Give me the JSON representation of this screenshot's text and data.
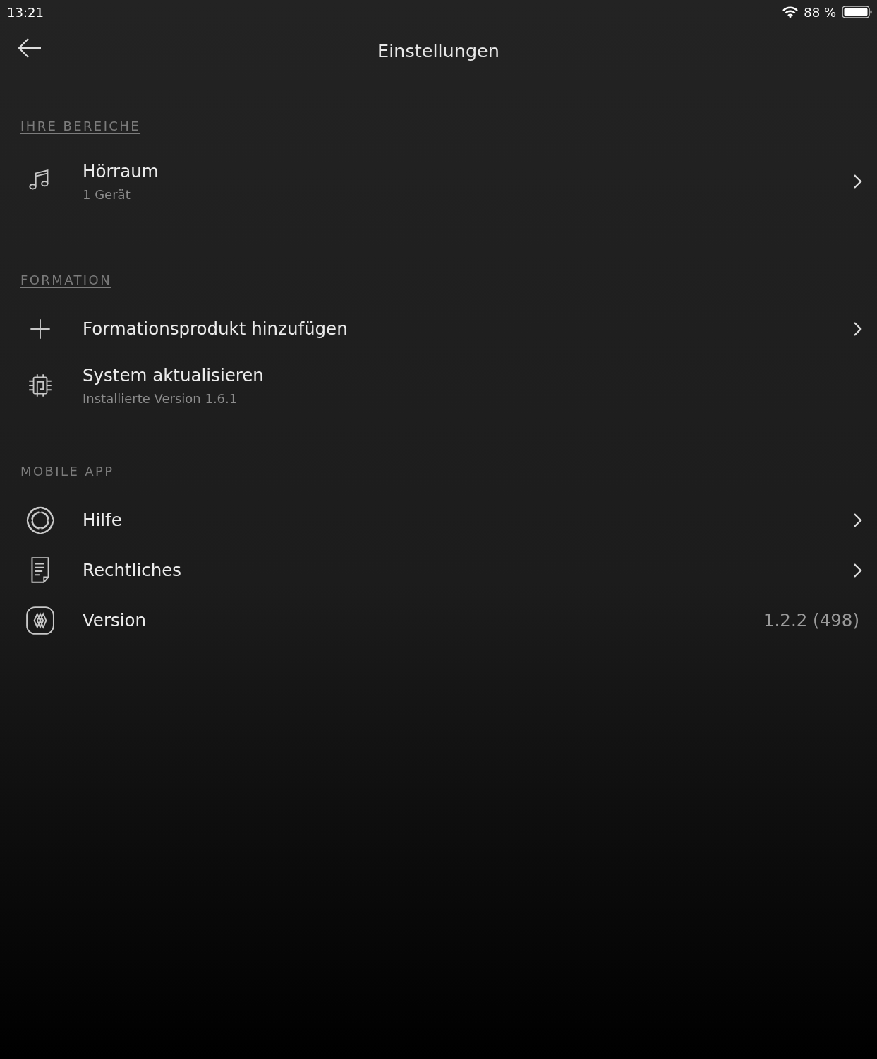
{
  "status_bar": {
    "time": "13:21",
    "battery_text": "88 %"
  },
  "header": {
    "title": "Einstellungen"
  },
  "sections": [
    {
      "label": "IHRE BEREICHE",
      "rows": [
        {
          "title": "Hörraum",
          "subtitle": "1 Gerät",
          "chevron": true
        }
      ]
    },
    {
      "label": "FORMATION",
      "rows": [
        {
          "title": "Formationsprodukt hinzufügen",
          "chevron": true
        },
        {
          "title": "System aktualisieren",
          "subtitle": "Installierte Version 1.6.1",
          "chevron": false
        }
      ]
    },
    {
      "label": "MOBILE APP",
      "rows": [
        {
          "title": "Hilfe",
          "chevron": true
        },
        {
          "title": "Rechtliches",
          "chevron": true
        },
        {
          "title": "Version",
          "value": "1.2.2 (498)",
          "chevron": false
        }
      ]
    }
  ]
}
